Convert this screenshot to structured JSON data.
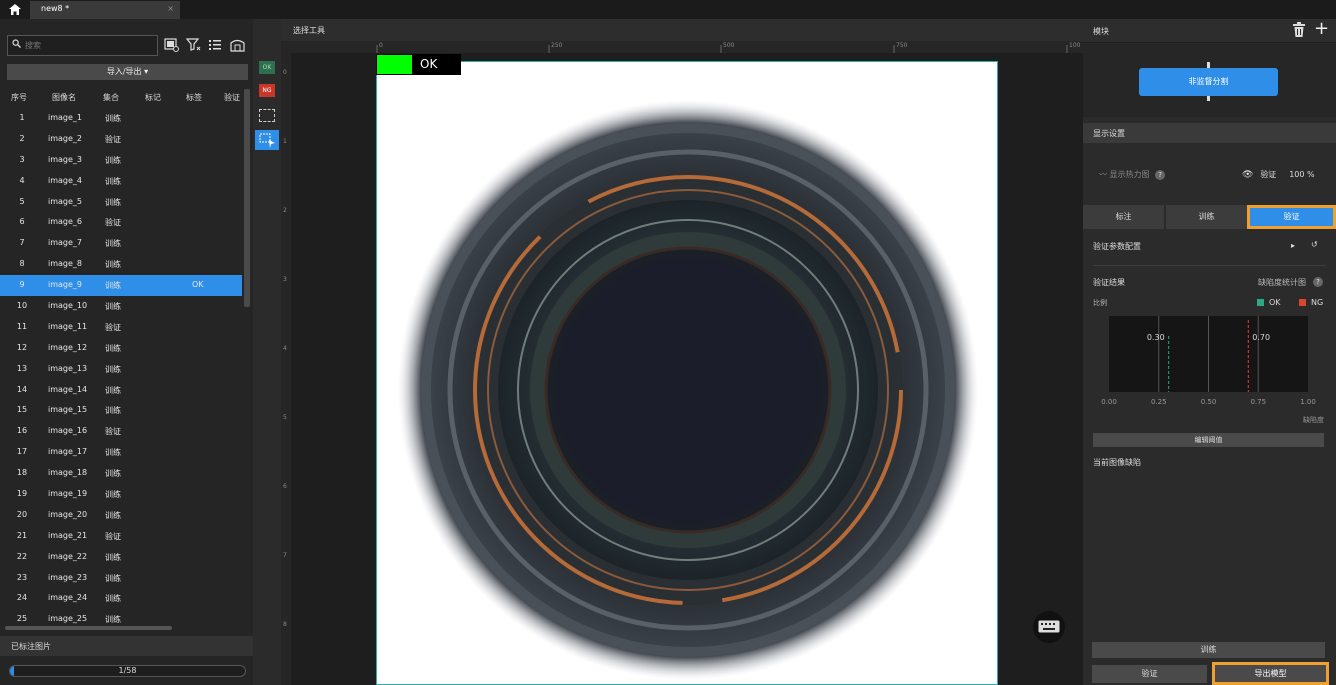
{
  "titlebar": {
    "tab_title": "new8 *",
    "tab_close": "×"
  },
  "left": {
    "search_placeholder": "搜索",
    "import_export": "导入/导出 ▾",
    "columns": [
      "序号",
      "图像名",
      "集合",
      "标记",
      "标签",
      "验证"
    ],
    "rows": [
      {
        "idx": "1",
        "name": "image_1",
        "set": "训练",
        "tag": ""
      },
      {
        "idx": "2",
        "name": "image_2",
        "set": "验证",
        "tag": ""
      },
      {
        "idx": "3",
        "name": "image_3",
        "set": "训练",
        "tag": ""
      },
      {
        "idx": "4",
        "name": "image_4",
        "set": "训练",
        "tag": ""
      },
      {
        "idx": "5",
        "name": "image_5",
        "set": "训练",
        "tag": ""
      },
      {
        "idx": "6",
        "name": "image_6",
        "set": "验证",
        "tag": ""
      },
      {
        "idx": "7",
        "name": "image_7",
        "set": "训练",
        "tag": ""
      },
      {
        "idx": "8",
        "name": "image_8",
        "set": "训练",
        "tag": ""
      },
      {
        "idx": "9",
        "name": "image_9",
        "set": "训练",
        "tag": "OK",
        "selected": true
      },
      {
        "idx": "10",
        "name": "image_10",
        "set": "训练",
        "tag": ""
      },
      {
        "idx": "11",
        "name": "image_11",
        "set": "验证",
        "tag": ""
      },
      {
        "idx": "12",
        "name": "image_12",
        "set": "训练",
        "tag": ""
      },
      {
        "idx": "13",
        "name": "image_13",
        "set": "训练",
        "tag": ""
      },
      {
        "idx": "14",
        "name": "image_14",
        "set": "训练",
        "tag": ""
      },
      {
        "idx": "15",
        "name": "image_15",
        "set": "训练",
        "tag": ""
      },
      {
        "idx": "16",
        "name": "image_16",
        "set": "验证",
        "tag": ""
      },
      {
        "idx": "17",
        "name": "image_17",
        "set": "训练",
        "tag": ""
      },
      {
        "idx": "18",
        "name": "image_18",
        "set": "训练",
        "tag": ""
      },
      {
        "idx": "19",
        "name": "image_19",
        "set": "训练",
        "tag": ""
      },
      {
        "idx": "20",
        "name": "image_20",
        "set": "训练",
        "tag": ""
      },
      {
        "idx": "21",
        "name": "image_21",
        "set": "验证",
        "tag": ""
      },
      {
        "idx": "22",
        "name": "image_22",
        "set": "训练",
        "tag": ""
      },
      {
        "idx": "23",
        "name": "image_23",
        "set": "训练",
        "tag": ""
      },
      {
        "idx": "24",
        "name": "image_24",
        "set": "训练",
        "tag": ""
      },
      {
        "idx": "25",
        "name": "image_25",
        "set": "训练",
        "tag": ""
      }
    ],
    "labeled_title": "已标注图片",
    "progress_text": "1/58",
    "progress_fraction": 0.017
  },
  "tools": {
    "ok_label": "OK",
    "ng_label": "NG"
  },
  "canvas": {
    "header": "选择工具",
    "ruler_top": [
      "0",
      "250",
      "500",
      "750",
      "100"
    ],
    "ruler_left": [
      "0",
      "1",
      "2",
      "3",
      "4",
      "5",
      "6",
      "7",
      "8",
      "9"
    ],
    "overlay_label": "OK",
    "overlay_color": "#00ff00"
  },
  "right": {
    "module_title": "模块",
    "module_button": "非监督分割",
    "display_settings": "显示设置",
    "heatmap_label": "显示热力图",
    "eye_label": "验证",
    "opacity": "100 %",
    "tabs": [
      "标注",
      "训练",
      "验证"
    ],
    "active_tab": "验证",
    "val_config": "验证参数配置",
    "val_result": "验证结果",
    "defect_chart": "缺陷度统计图",
    "ratio_label": "比例",
    "legend_ok": "OK",
    "legend_ng": "NG",
    "edit_threshold": "编辑阈值",
    "current_defects": "当前图像缺陷",
    "train_button": "训练",
    "validate_button": "验证",
    "export_button": "导出模型",
    "accent": "#2f8fe8",
    "highlight": "#f0a030"
  },
  "chart_data": {
    "type": "line",
    "x_ticks": [
      "0.00",
      "0.25",
      "0.50",
      "0.75",
      "1.00"
    ],
    "xlim": [
      0,
      1
    ],
    "xlabel": "缺陷度",
    "ok_threshold": 0.3,
    "ng_threshold": 0.7,
    "ok_label": "0.30",
    "ng_label": "0.70",
    "ok_color": "#2ea888",
    "ng_color": "#d9452e"
  }
}
